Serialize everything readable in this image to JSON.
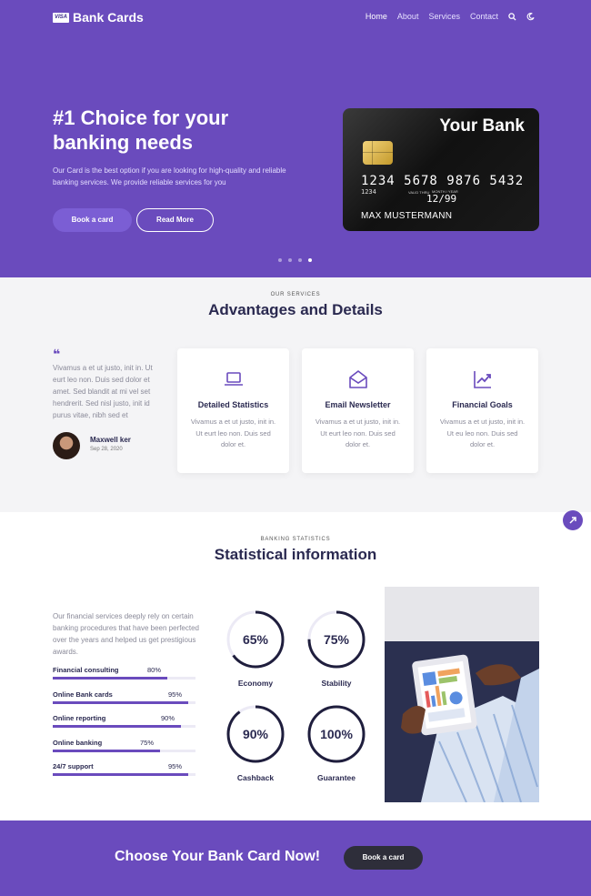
{
  "nav": {
    "logo_badge": "VISA",
    "logo_text": "Bank Cards",
    "items": [
      "Home",
      "About",
      "Services",
      "Contact"
    ]
  },
  "hero": {
    "title": "#1 Choice for your banking needs",
    "description": "Our Card is the best option if you are looking for high-quality and reliable banking services. We provide reliable services for you",
    "primary_button": "Book a card",
    "secondary_button": "Read More",
    "card": {
      "bank_name": "Your Bank",
      "number": "1234 5678 9876 5432",
      "small_number": "1234",
      "valid_thru": "VALID THRU",
      "month_year": "MONTH / YEAR",
      "expiry": "12/99",
      "holder": "MAX MUSTERMANN"
    },
    "slides_total": 4,
    "slide_active": 4
  },
  "services": {
    "eyebrow": "OUR SERVICES",
    "title": "Advantages and Details",
    "quote_mark": "❝",
    "testimonial": "Vivamus a et ut justo, init in. Ut eurt leo non. Duis sed dolor et amet. Sed blandit at mi vel set hendrerit. Sed nisl justo, init id purus vitae, nibh sed et",
    "author_name": "Maxwell ker",
    "author_date": "Sep 28, 2020",
    "cards": [
      {
        "icon": "laptop-icon",
        "title": "Detailed Statistics",
        "text": "Vivamus a et ut justo, init in. Ut eurt leo non. Duis sed dolor et."
      },
      {
        "icon": "envelope-open-icon",
        "title": "Email Newsletter",
        "text": "Vivamus a et ut justo, init in. Ut eurt leo non. Duis sed dolor et."
      },
      {
        "icon": "trending-up-icon",
        "title": "Financial Goals",
        "text": "Vivamus a et ut justo, init in. Ut eu leo non. Duis sed dolor et."
      }
    ]
  },
  "stats": {
    "eyebrow": "BANKING STATISTICS",
    "title": "Statistical information",
    "description": "Our financial services deeply rely on certain banking procedures that have been perfected over the years and helped us get prestigious awards.",
    "bars": [
      {
        "label": "Financial consulting",
        "percent": 80,
        "pct_text": "80%"
      },
      {
        "label": "Online Bank cards",
        "percent": 95,
        "pct_text": "95%"
      },
      {
        "label": "Online reporting",
        "percent": 90,
        "pct_text": "90%"
      },
      {
        "label": "Online banking",
        "percent": 75,
        "pct_text": "75%"
      },
      {
        "label": "24/7 support",
        "percent": 95,
        "pct_text": "95%"
      }
    ],
    "rings": [
      {
        "value": "65%",
        "percent": 65,
        "label": "Economy"
      },
      {
        "value": "75%",
        "percent": 75,
        "label": "Stability"
      },
      {
        "value": "90%",
        "percent": 90,
        "label": "Cashback"
      },
      {
        "value": "100%",
        "percent": 100,
        "label": "Guarantee"
      }
    ]
  },
  "cta": {
    "title": "Choose Your Bank Card Now!",
    "button": "Book a card"
  },
  "colors": {
    "brand_purple": "#6a4bbd",
    "navy_text": "#2a2950",
    "muted_text": "#8a8a99"
  }
}
